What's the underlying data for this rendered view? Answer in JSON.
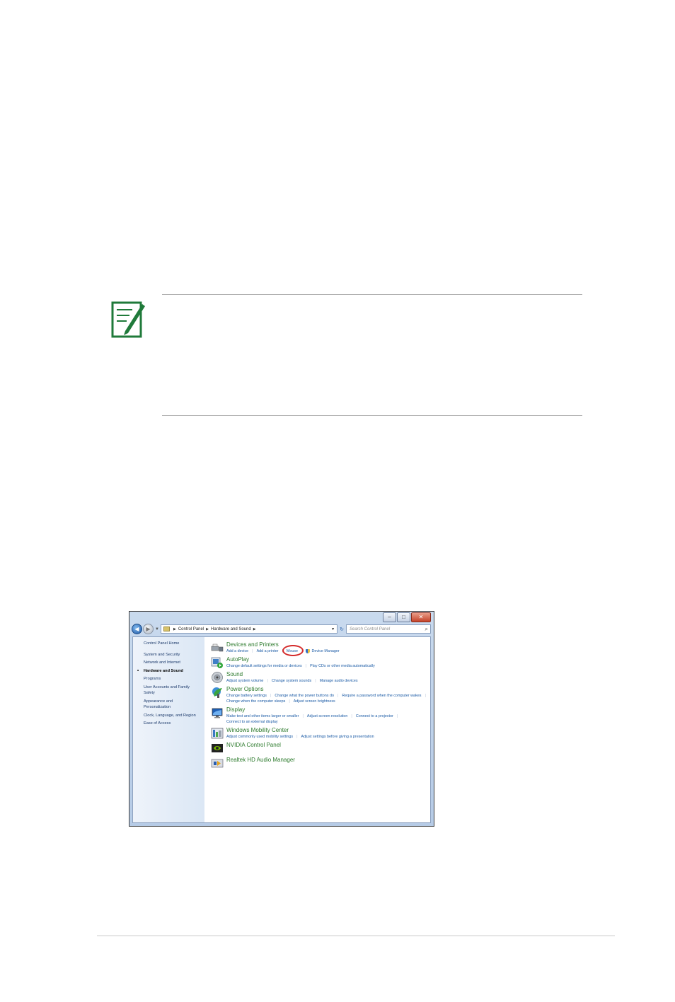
{
  "window": {
    "caption": {
      "minimize": "–",
      "maximize": "□",
      "close": "✕"
    },
    "address": {
      "crumbs": [
        "Control Panel",
        "Hardware and Sound"
      ]
    },
    "search": {
      "placeholder": "Search Control Panel"
    }
  },
  "sidebar": {
    "items": [
      "Control Panel Home",
      "System and Security",
      "Network and Internet",
      "Hardware and Sound",
      "Programs",
      "User Accounts and Family",
      "Safety",
      "Appearance and",
      "Personalization",
      "Clock, Language, and Region",
      "Ease of Access"
    ]
  },
  "categories": [
    {
      "title": "Devices and Printers",
      "links": [
        "Add a device",
        "Add a printer",
        "Mouse",
        "Device Manager"
      ],
      "icon": "printer-icon"
    },
    {
      "title": "AutoPlay",
      "links": [
        "Change default settings for media or devices",
        "Play CDs or other media automatically"
      ],
      "icon": "autoplay-icon"
    },
    {
      "title": "Sound",
      "links": [
        "Adjust system volume",
        "Change system sounds",
        "Manage audio devices"
      ],
      "icon": "speaker-icon"
    },
    {
      "title": "Power Options",
      "links": [
        "Change battery settings",
        "Change what the power buttons do",
        "Require a password when the computer wakes",
        "Change when the computer sleeps",
        "Adjust screen brightness"
      ],
      "icon": "power-icon"
    },
    {
      "title": "Display",
      "links": [
        "Make text and other items larger or smaller",
        "Adjust screen resolution",
        "Connect to a projector",
        "Connect to an external display"
      ],
      "icon": "display-icon"
    },
    {
      "title": "Windows Mobility Center",
      "links": [
        "Adjust commonly used mobility settings",
        "Adjust settings before giving a presentation"
      ],
      "icon": "mobility-icon"
    },
    {
      "title": "NVIDIA Control Panel",
      "links": [],
      "icon": "nvidia-icon"
    },
    {
      "title": "Realtek HD Audio Manager",
      "links": [],
      "icon": "realtek-icon"
    }
  ],
  "colors": {
    "accent_title": "#2c7a2c",
    "link": "#1a5aa5",
    "highlight_circle": "#d42a2a",
    "note_icon": "#1f7a3a"
  }
}
